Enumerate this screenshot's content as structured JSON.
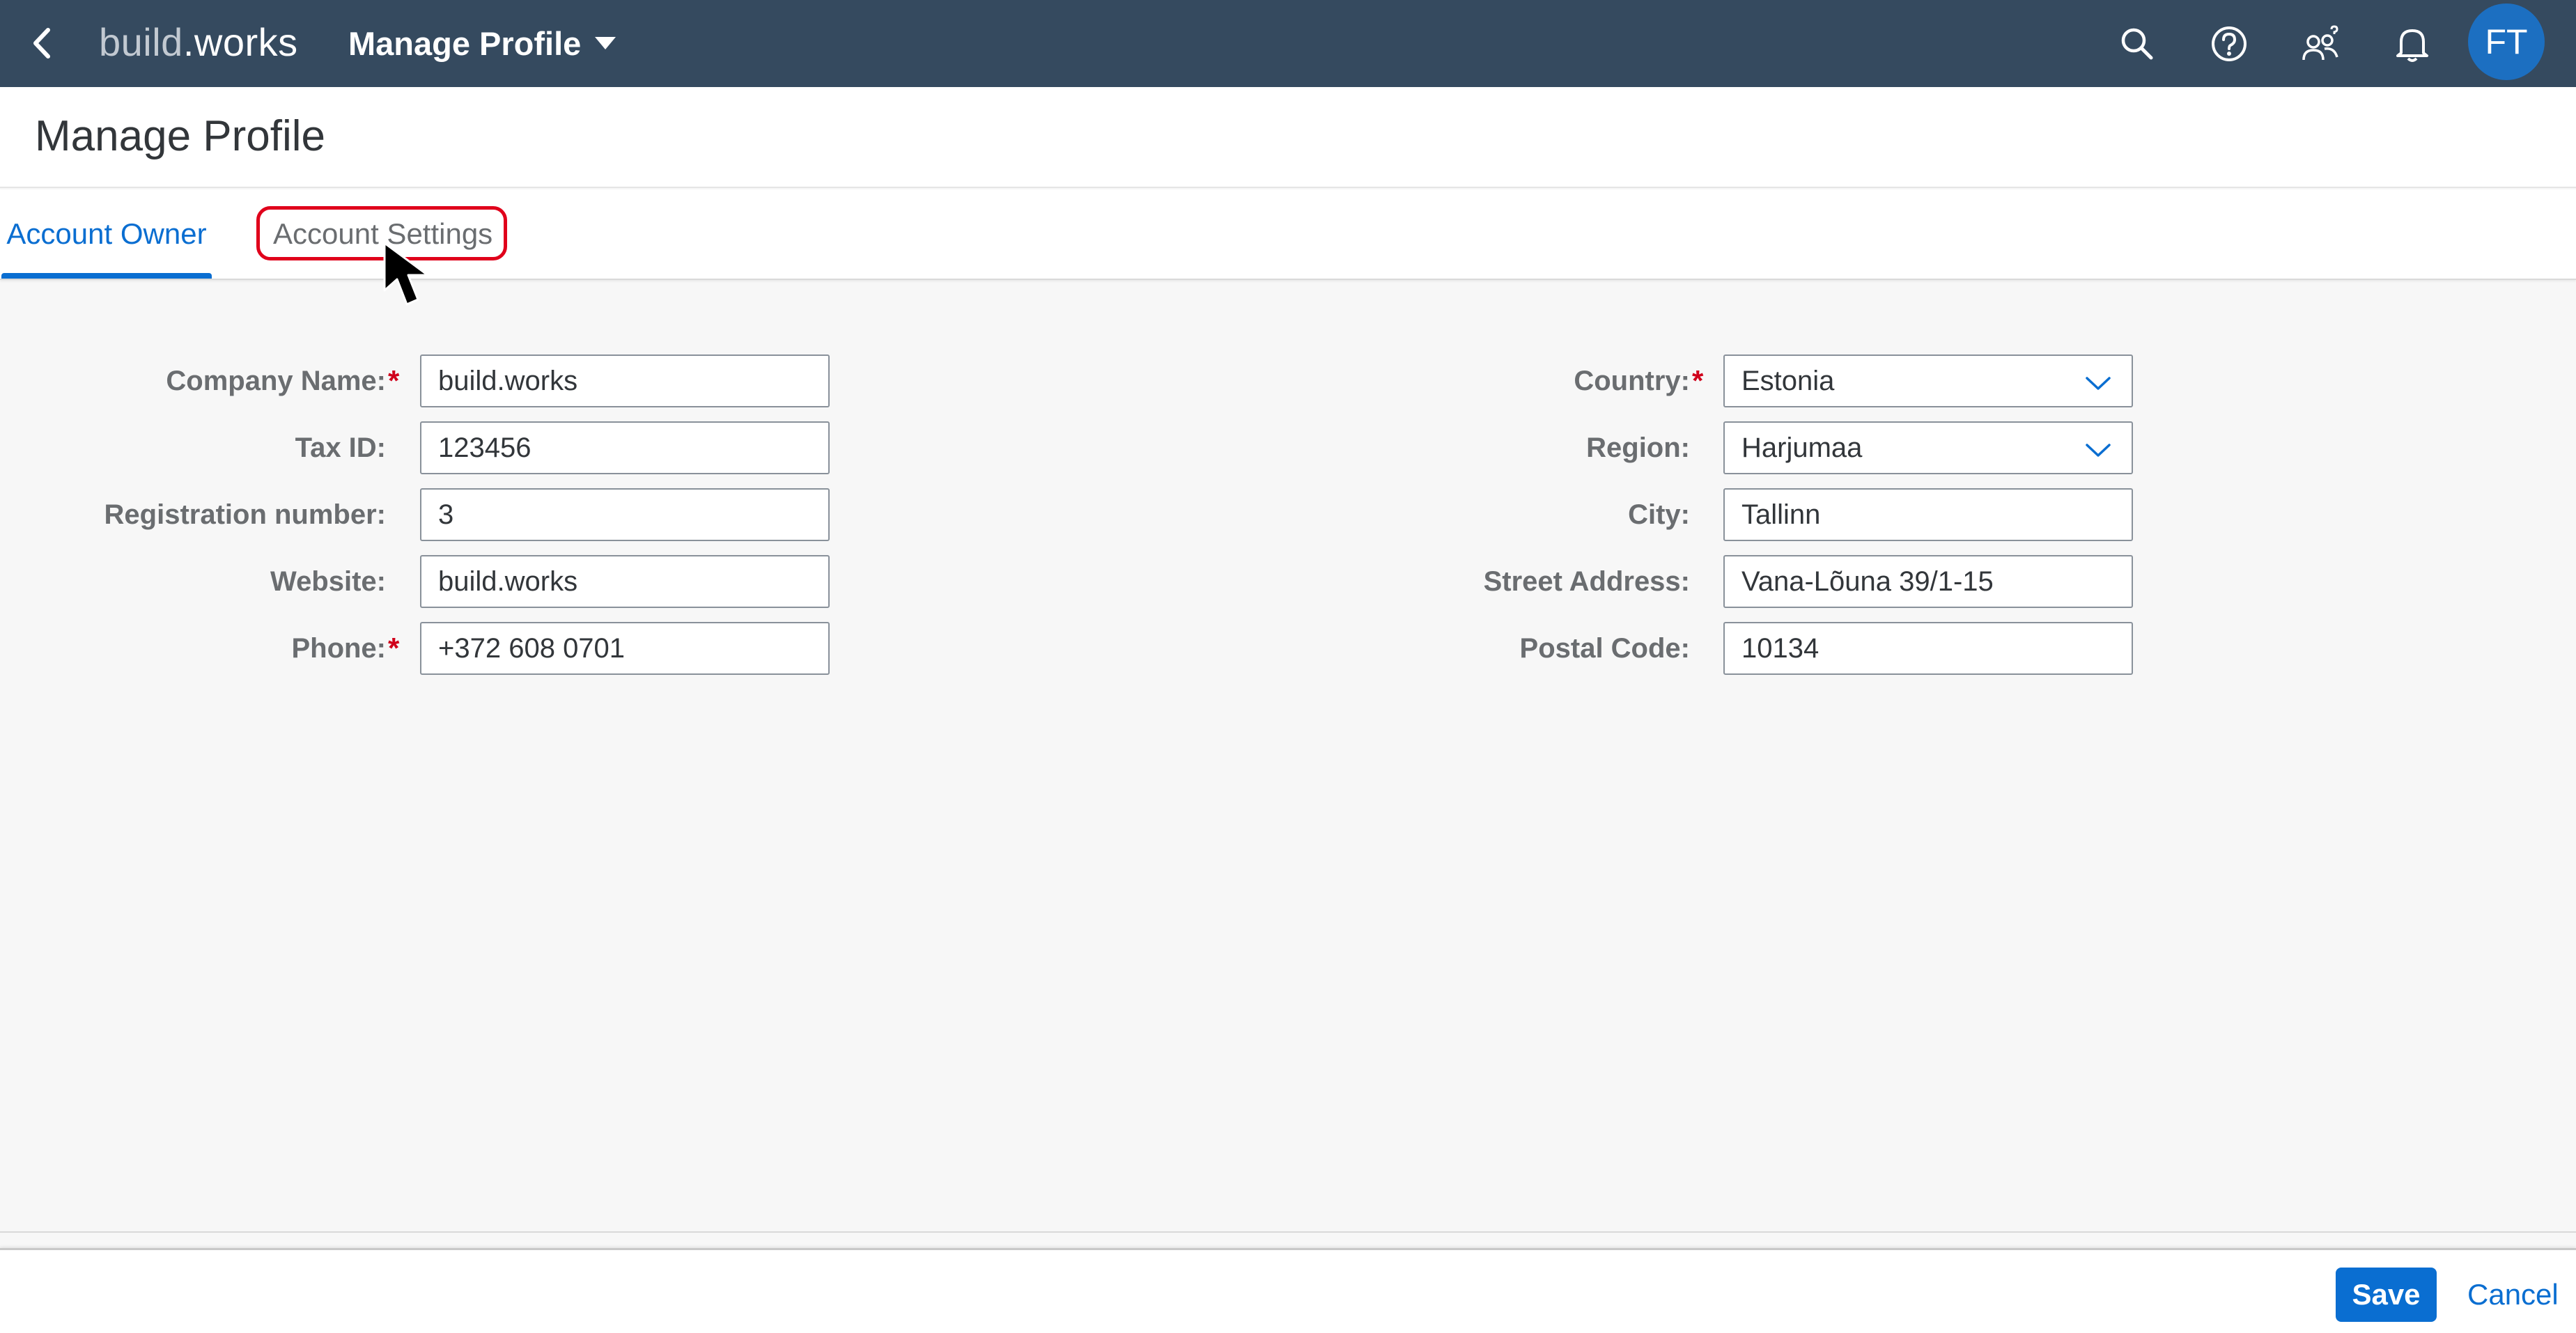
{
  "shell": {
    "logo_part1": "build",
    "logo_part2": ".works",
    "app_title": "Manage Profile",
    "avatar_initials": "FT",
    "icons": [
      "back-icon",
      "search-icon",
      "help-icon",
      "user-group-icon",
      "bell-icon",
      "caret-down-icon"
    ]
  },
  "page": {
    "title": "Manage Profile"
  },
  "tabs": [
    {
      "label": "Account Owner",
      "selected": true
    },
    {
      "label": "Account Settings",
      "selected": false
    }
  ],
  "form": {
    "left": [
      {
        "label": "Company Name:",
        "required": true,
        "value": "build.works"
      },
      {
        "label": "Tax ID:",
        "required": false,
        "value": "123456"
      },
      {
        "label": "Registration number:",
        "required": false,
        "value": "3"
      },
      {
        "label": "Website:",
        "required": false,
        "value": "build.works"
      },
      {
        "label": "Phone:",
        "required": true,
        "value": "+372 608 0701"
      }
    ],
    "right": [
      {
        "label": "Country:",
        "required": true,
        "value": "Estonia",
        "type": "select"
      },
      {
        "label": "Region:",
        "required": false,
        "value": "Harjumaa",
        "type": "select"
      },
      {
        "label": "City:",
        "required": false,
        "value": "Tallinn"
      },
      {
        "label": "Street Address:",
        "required": false,
        "value": "Vana-Lõuna 39/1-15"
      },
      {
        "label": "Postal Code:",
        "required": false,
        "value": "10134"
      }
    ],
    "required_mark": "*"
  },
  "footer": {
    "save_label": "Save",
    "cancel_label": "Cancel"
  },
  "colors": {
    "shell_bg": "#354a5f",
    "accent": "#0a6ed1",
    "required": "#d0001b",
    "highlight": "#e0001b"
  }
}
